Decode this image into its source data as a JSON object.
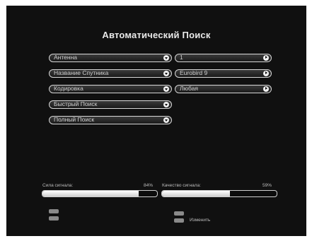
{
  "title": "Автоматический Поиск",
  "left_menu": [
    {
      "label": "Антенна"
    },
    {
      "label": "Название Спутника"
    },
    {
      "label": "Кодировка"
    },
    {
      "label": "Быстрый Поиск"
    },
    {
      "label": "Полный Поиск"
    }
  ],
  "right_values": [
    {
      "label": "1"
    },
    {
      "label": "Eurobird 9"
    },
    {
      "label": "Любая"
    }
  ],
  "signal": {
    "strength_label": "Сила сигнала:",
    "strength_value": "84%",
    "strength_fraction": 0.84,
    "quality_label": "Качество сигнала:",
    "quality_value": "59%",
    "quality_fraction": 0.59
  },
  "footer": {
    "change_label": "Изменить"
  },
  "icons": {
    "dropdown": "chevron-down-icon",
    "next": "arrow-right-icon"
  }
}
